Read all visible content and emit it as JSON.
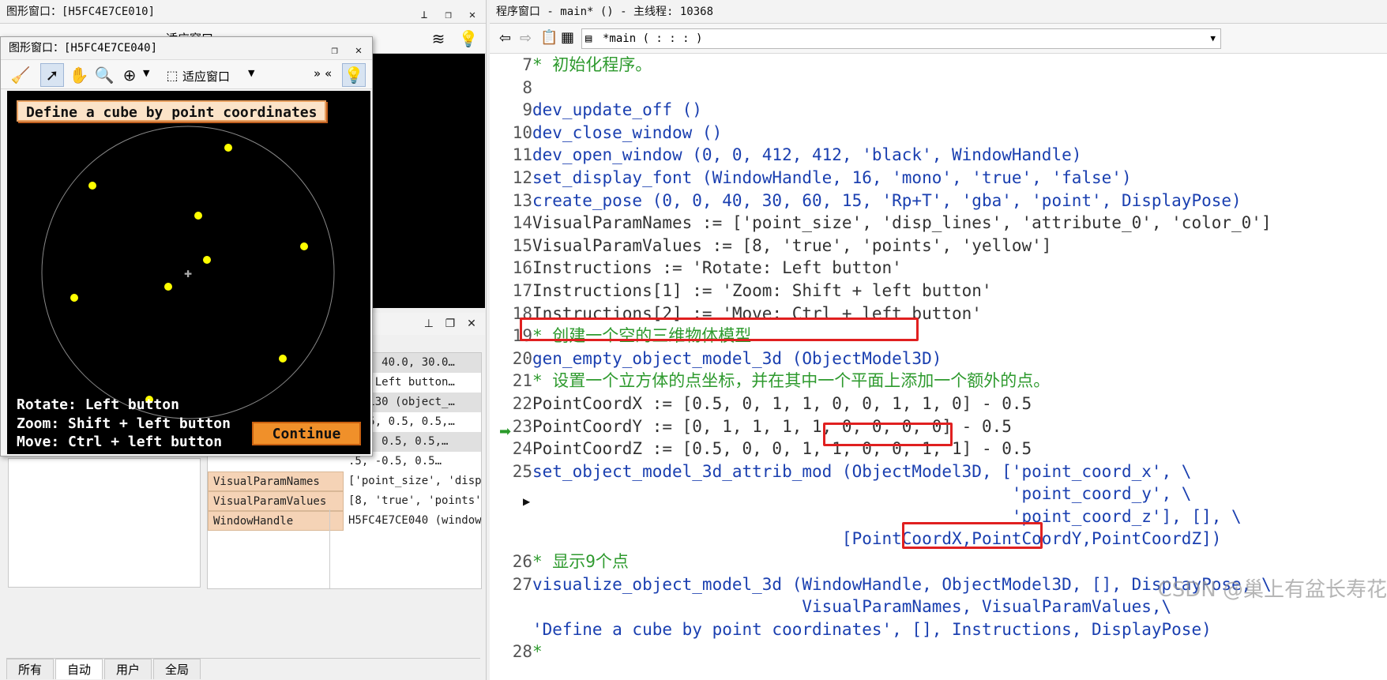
{
  "left_window": {
    "title": "图形窗口：[H5FC4E7CE010]",
    "toolbar_label": "适应窗口"
  },
  "graph_window": {
    "title": "图形窗口：[H5FC4E7CE040]",
    "toolbar_label": "适应窗口",
    "banner": "Define a cube by point coordinates",
    "instructions": [
      "Rotate: Left button",
      "Zoom: Shift + left button",
      "Move: Ctrl + left button"
    ],
    "continue_label": "Continue"
  },
  "variables": {
    "partial_values": [
      "0.0, 40.0, 30.0…",
      "te: Left button…",
      "7CE130 (object_…",
      "-0.5, 0.5, 0.5,…",
      "0.5, 0.5, 0.5,…",
      ".5, -0.5, 0.5…"
    ],
    "rows": [
      {
        "name": "VisualParamNames",
        "value": "['point_size', 'disp_…"
      },
      {
        "name": "VisualParamValues",
        "value": "[8, 'true', 'points',…"
      },
      {
        "name": "WindowHandle",
        "value": "H5FC4E7CE040 (window)"
      }
    ]
  },
  "bottom_tabs": [
    "所有",
    "自动",
    "用户",
    "全局"
  ],
  "program_window": {
    "title": "程序窗口 - main* () - 主线程: 10368",
    "procedure": "*main ( : : : )",
    "watermark": "CSDN @巢上有盆长寿花"
  },
  "code_lines": [
    {
      "n": "7",
      "text": "* 初始化程序。",
      "cls": "c-green"
    },
    {
      "n": "8",
      "text": "",
      "cls": ""
    },
    {
      "n": "9",
      "text": "dev_update_off ()",
      "cls": "c-blue"
    },
    {
      "n": "10",
      "text": "dev_close_window ()",
      "cls": "c-blue"
    },
    {
      "n": "11",
      "text": "dev_open_window (0, 0, 412, 412, 'black', WindowHandle)",
      "cls": "c-blue"
    },
    {
      "n": "12",
      "text": "set_display_font (WindowHandle, 16, 'mono', 'true', 'false')",
      "cls": "c-blue"
    },
    {
      "n": "13",
      "text": "create_pose (0, 0, 40, 30, 60, 15, 'Rp+T', 'gba', 'point', DisplayPose)",
      "cls": "c-blue"
    },
    {
      "n": "14",
      "text": "VisualParamNames := ['point_size', 'disp_lines', 'attribute_0', 'color_0']",
      "cls": "c-dark"
    },
    {
      "n": "15",
      "text": "VisualParamValues := [8, 'true', 'points', 'yellow']",
      "cls": "c-dark"
    },
    {
      "n": "16",
      "text": "Instructions := 'Rotate: Left button'",
      "cls": "c-dark"
    },
    {
      "n": "17",
      "text": "Instructions[1] := 'Zoom: Shift + left button'",
      "cls": "c-dark"
    },
    {
      "n": "18",
      "text": "Instructions[2] := 'Move: Ctrl + left button'",
      "cls": "c-dark"
    },
    {
      "n": "19",
      "text": "* 创建一个空的三维物体模型",
      "cls": "c-green"
    },
    {
      "n": "20",
      "text": "gen_empty_object_model_3d (ObjectModel3D)",
      "cls": "c-blue"
    },
    {
      "n": "21",
      "text": "* 设置一个立方体的点坐标，并在其中一个平面上添加一个额外的点。",
      "cls": "c-green"
    },
    {
      "n": "22",
      "text": "PointCoordX := [0.5, 0, 1, 1, 0, 0, 1, 1, 0] - 0.5",
      "cls": "c-dark"
    },
    {
      "n": "23",
      "text": "PointCoordY := [0, 1, 1, 1, 1, 0, 0, 0, 0] - 0.5",
      "cls": "c-dark"
    },
    {
      "n": "24",
      "text": "PointCoordZ := [0.5, 0, 0, 1, 1, 0, 0, 1, 1] - 0.5",
      "cls": "c-dark"
    },
    {
      "n": "25",
      "text": "set_object_model_3d_attrib_mod (ObjectModel3D, ['point_coord_x', \\",
      "cls": "c-blue"
    },
    {
      "n": "",
      "text": "                                                'point_coord_y', \\",
      "cls": "c-blue"
    },
    {
      "n": "",
      "text": "                                                'point_coord_z'], [], \\",
      "cls": "c-blue"
    },
    {
      "n": "",
      "text": "                               [PointCoordX,PointCoordY,PointCoordZ])",
      "cls": "c-blue"
    },
    {
      "n": "26",
      "text": "* 显示9个点",
      "cls": "c-green"
    },
    {
      "n": "27",
      "text": "visualize_object_model_3d (WindowHandle, ObjectModel3D, [], DisplayPose, \\",
      "cls": "c-blue"
    },
    {
      "n": "",
      "text": "                           VisualParamNames, VisualParamValues,\\",
      "cls": "c-blue"
    },
    {
      "n": "",
      "text": "'Define a cube by point coordinates', [], Instructions, DisplayPose)",
      "cls": "c-blue"
    },
    {
      "n": "28",
      "text": "*",
      "cls": "c-green"
    }
  ]
}
